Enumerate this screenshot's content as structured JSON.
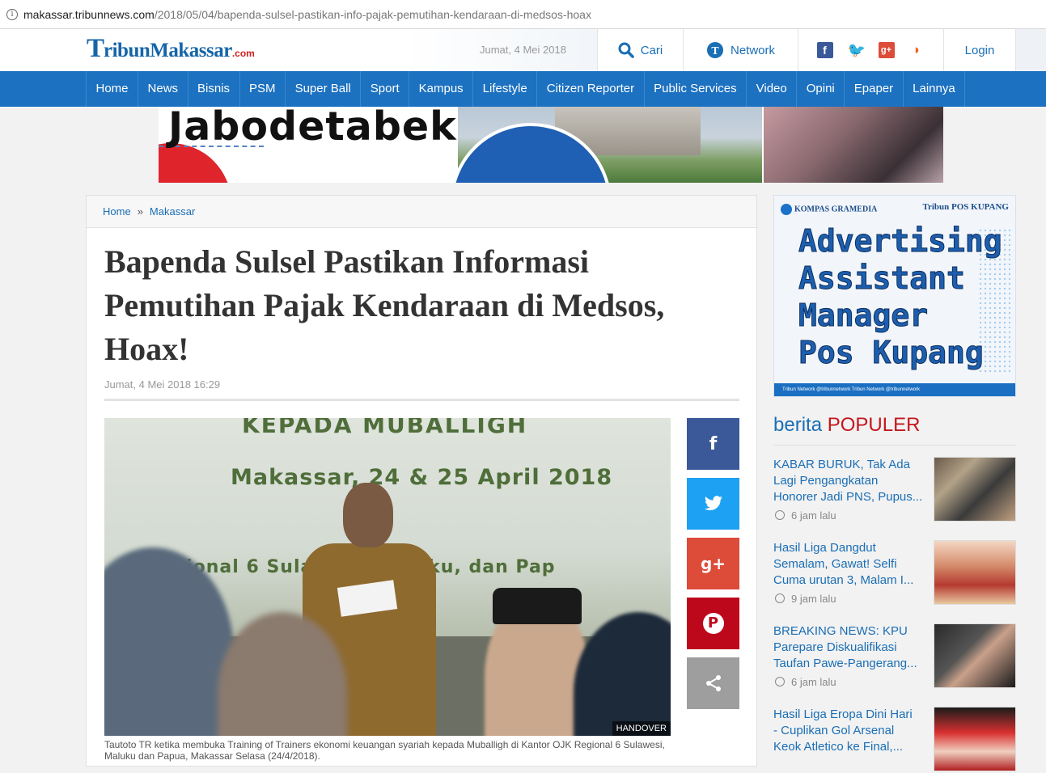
{
  "browser": {
    "url_host": "makassar.tribunnews.com",
    "url_path": "/2018/05/04/bapenda-sulsel-pastikan-info-pajak-pemutihan-kendaraan-di-medsos-hoax"
  },
  "header": {
    "logo_t": "T",
    "logo_word": "ribunMakassar",
    "logo_com": ".com",
    "date": "Jumat, 4 Mei 2018",
    "search_label": "Cari",
    "network_label": "Network",
    "login_label": "Login"
  },
  "nav": {
    "items": [
      "Home",
      "News",
      "Bisnis",
      "PSM",
      "Super Ball",
      "Sport",
      "Kampus",
      "Lifestyle",
      "Citizen Reporter",
      "Public Services",
      "Video",
      "Opini",
      "Epaper",
      "Lainnya"
    ]
  },
  "banner": {
    "headline": "Jabodetabek"
  },
  "breadcrumb": {
    "home": "Home",
    "separator": "»",
    "section": "Makassar"
  },
  "article": {
    "title": "Bapenda Sulsel Pastikan Informasi Pemutihan Pajak Kendaraan di Medsos, Hoax!",
    "date": "Jumat, 4 Mei 2018 16:29",
    "image_text_1": "KEPADA MUBALLIGH",
    "image_text_2": "Makassar, 24 & 25 April 2018",
    "image_text_3": "r Regional 6 Sulawesi, Maluku, dan Pap",
    "image_credit": "HANDOVER",
    "caption": "Tautoto TR ketika membuka Training of Trainers ekonomi keuangan syariah kepada Muballigh di Kantor OJK Regional 6 Sulawesi, Maluku dan Papua, Makassar Selasa (24/4/2018)."
  },
  "share": {
    "facebook": "f",
    "twitter": "🐦",
    "googleplus": "g+",
    "pinterest": "P",
    "more": "share-icon"
  },
  "ad": {
    "kompas": "KOMPAS GRAMEDIA",
    "brand": "Tribun POS KUPANG",
    "line1": "Advertising",
    "line2": "Assistant",
    "line3": "Manager",
    "line4": "Pos Kupang",
    "footer": "Tribun Network    @tribunnetwork    Tribun Network    @tribunnetwork"
  },
  "popular": {
    "title_prefix": "berita",
    "title_hot": "POPULER",
    "items": [
      {
        "lines": [
          "KABAR BURUK, Tak Ada",
          "Lagi Pengangkatan",
          "Honorer Jadi PNS, Pupus..."
        ],
        "time": "6 jam lalu"
      },
      {
        "lines": [
          "Hasil Liga Dangdut",
          "Semalam, Gawat! Selfi",
          "Cuma urutan 3, Malam I..."
        ],
        "time": "9 jam lalu"
      },
      {
        "lines": [
          "BREAKING NEWS: KPU",
          "Parepare Diskualifikasi",
          "Taufan Pawe-Pangerang..."
        ],
        "time": "6 jam lalu"
      },
      {
        "lines": [
          "Hasil Liga Eropa Dini Hari",
          "- Cuplikan Gol Arsenal",
          "Keok Atletico ke Final,..."
        ],
        "time": ""
      }
    ]
  }
}
